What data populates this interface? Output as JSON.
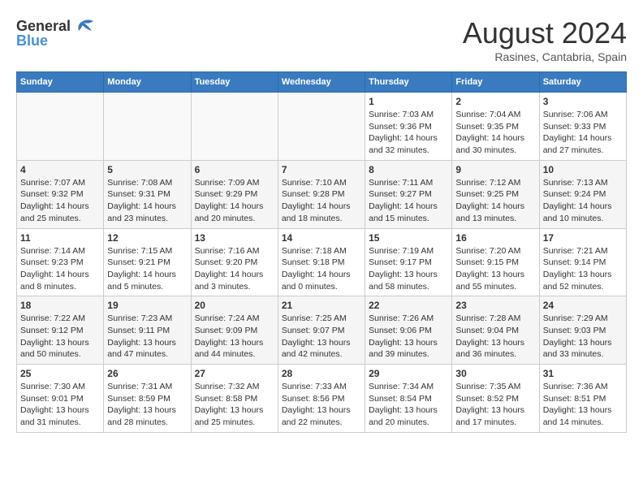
{
  "header": {
    "logo_general": "General",
    "logo_blue": "Blue",
    "month_year": "August 2024",
    "location": "Rasines, Cantabria, Spain"
  },
  "weekdays": [
    "Sunday",
    "Monday",
    "Tuesday",
    "Wednesday",
    "Thursday",
    "Friday",
    "Saturday"
  ],
  "weeks": [
    [
      {
        "day": "",
        "info": ""
      },
      {
        "day": "",
        "info": ""
      },
      {
        "day": "",
        "info": ""
      },
      {
        "day": "",
        "info": ""
      },
      {
        "day": "1",
        "info": "Sunrise: 7:03 AM\nSunset: 9:36 PM\nDaylight: 14 hours\nand 32 minutes."
      },
      {
        "day": "2",
        "info": "Sunrise: 7:04 AM\nSunset: 9:35 PM\nDaylight: 14 hours\nand 30 minutes."
      },
      {
        "day": "3",
        "info": "Sunrise: 7:06 AM\nSunset: 9:33 PM\nDaylight: 14 hours\nand 27 minutes."
      }
    ],
    [
      {
        "day": "4",
        "info": "Sunrise: 7:07 AM\nSunset: 9:32 PM\nDaylight: 14 hours\nand 25 minutes."
      },
      {
        "day": "5",
        "info": "Sunrise: 7:08 AM\nSunset: 9:31 PM\nDaylight: 14 hours\nand 23 minutes."
      },
      {
        "day": "6",
        "info": "Sunrise: 7:09 AM\nSunset: 9:29 PM\nDaylight: 14 hours\nand 20 minutes."
      },
      {
        "day": "7",
        "info": "Sunrise: 7:10 AM\nSunset: 9:28 PM\nDaylight: 14 hours\nand 18 minutes."
      },
      {
        "day": "8",
        "info": "Sunrise: 7:11 AM\nSunset: 9:27 PM\nDaylight: 14 hours\nand 15 minutes."
      },
      {
        "day": "9",
        "info": "Sunrise: 7:12 AM\nSunset: 9:25 PM\nDaylight: 14 hours\nand 13 minutes."
      },
      {
        "day": "10",
        "info": "Sunrise: 7:13 AM\nSunset: 9:24 PM\nDaylight: 14 hours\nand 10 minutes."
      }
    ],
    [
      {
        "day": "11",
        "info": "Sunrise: 7:14 AM\nSunset: 9:23 PM\nDaylight: 14 hours\nand 8 minutes."
      },
      {
        "day": "12",
        "info": "Sunrise: 7:15 AM\nSunset: 9:21 PM\nDaylight: 14 hours\nand 5 minutes."
      },
      {
        "day": "13",
        "info": "Sunrise: 7:16 AM\nSunset: 9:20 PM\nDaylight: 14 hours\nand 3 minutes."
      },
      {
        "day": "14",
        "info": "Sunrise: 7:18 AM\nSunset: 9:18 PM\nDaylight: 14 hours\nand 0 minutes."
      },
      {
        "day": "15",
        "info": "Sunrise: 7:19 AM\nSunset: 9:17 PM\nDaylight: 13 hours\nand 58 minutes."
      },
      {
        "day": "16",
        "info": "Sunrise: 7:20 AM\nSunset: 9:15 PM\nDaylight: 13 hours\nand 55 minutes."
      },
      {
        "day": "17",
        "info": "Sunrise: 7:21 AM\nSunset: 9:14 PM\nDaylight: 13 hours\nand 52 minutes."
      }
    ],
    [
      {
        "day": "18",
        "info": "Sunrise: 7:22 AM\nSunset: 9:12 PM\nDaylight: 13 hours\nand 50 minutes."
      },
      {
        "day": "19",
        "info": "Sunrise: 7:23 AM\nSunset: 9:11 PM\nDaylight: 13 hours\nand 47 minutes."
      },
      {
        "day": "20",
        "info": "Sunrise: 7:24 AM\nSunset: 9:09 PM\nDaylight: 13 hours\nand 44 minutes."
      },
      {
        "day": "21",
        "info": "Sunrise: 7:25 AM\nSunset: 9:07 PM\nDaylight: 13 hours\nand 42 minutes."
      },
      {
        "day": "22",
        "info": "Sunrise: 7:26 AM\nSunset: 9:06 PM\nDaylight: 13 hours\nand 39 minutes."
      },
      {
        "day": "23",
        "info": "Sunrise: 7:28 AM\nSunset: 9:04 PM\nDaylight: 13 hours\nand 36 minutes."
      },
      {
        "day": "24",
        "info": "Sunrise: 7:29 AM\nSunset: 9:03 PM\nDaylight: 13 hours\nand 33 minutes."
      }
    ],
    [
      {
        "day": "25",
        "info": "Sunrise: 7:30 AM\nSunset: 9:01 PM\nDaylight: 13 hours\nand 31 minutes."
      },
      {
        "day": "26",
        "info": "Sunrise: 7:31 AM\nSunset: 8:59 PM\nDaylight: 13 hours\nand 28 minutes."
      },
      {
        "day": "27",
        "info": "Sunrise: 7:32 AM\nSunset: 8:58 PM\nDaylight: 13 hours\nand 25 minutes."
      },
      {
        "day": "28",
        "info": "Sunrise: 7:33 AM\nSunset: 8:56 PM\nDaylight: 13 hours\nand 22 minutes."
      },
      {
        "day": "29",
        "info": "Sunrise: 7:34 AM\nSunset: 8:54 PM\nDaylight: 13 hours\nand 20 minutes."
      },
      {
        "day": "30",
        "info": "Sunrise: 7:35 AM\nSunset: 8:52 PM\nDaylight: 13 hours\nand 17 minutes."
      },
      {
        "day": "31",
        "info": "Sunrise: 7:36 AM\nSunset: 8:51 PM\nDaylight: 13 hours\nand 14 minutes."
      }
    ]
  ]
}
